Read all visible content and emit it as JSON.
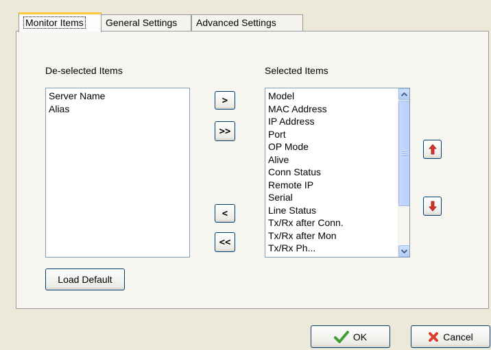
{
  "tabs": [
    {
      "label": "Monitor Items",
      "active": true
    },
    {
      "label": "General Settings",
      "active": false
    },
    {
      "label": "Advanced Settings",
      "active": false
    }
  ],
  "deselected": {
    "label": "De-selected Items",
    "items": [
      "Server Name",
      "Alias"
    ]
  },
  "selected": {
    "label": "Selected Items",
    "items": [
      "Model",
      "MAC Address",
      "IP Address",
      "Port",
      "OP Mode",
      "Alive",
      "Conn Status",
      "Remote IP",
      "Serial",
      "Line Status",
      "Tx/Rx after Conn.",
      "Tx/Rx after Mon",
      "Tx/Rx Ph..."
    ]
  },
  "transfer": {
    "add_one": ">",
    "add_all": ">>",
    "remove_one": "<",
    "remove_all": "<<"
  },
  "order": {
    "up_icon": "arrow-up-icon",
    "down_icon": "arrow-down-icon",
    "icon_color": "#e0322c"
  },
  "load_default_label": "Load Default",
  "ok_label": "OK",
  "cancel_label": "Cancel",
  "icons": {
    "ok": "checkmark-icon",
    "cancel": "x-icon"
  },
  "colors": {
    "tab_highlight": "#ffc83c",
    "ok_icon": "#3ea02c",
    "cancel_icon": "#d8402c"
  }
}
